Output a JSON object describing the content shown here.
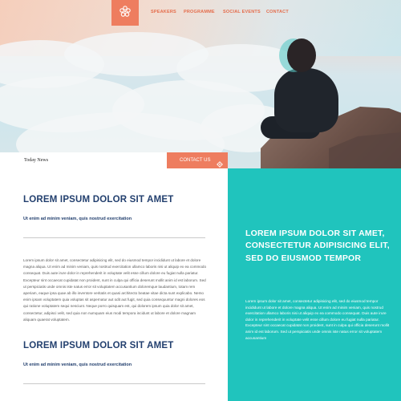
{
  "nav": {
    "items": [
      {
        "label": "SPEAKERS"
      },
      {
        "label": "PROGRAMME"
      },
      {
        "label": "SOCIAL EVENTS"
      },
      {
        "label": "CONTACT"
      }
    ]
  },
  "subbar": {
    "today_news": "Today News",
    "contact_label": "CONTACT US"
  },
  "main": {
    "heading_1": "LOREM IPSUM DOLOR SIT AMET",
    "subheading_1": "Ut enim ad minim veniam, quis nostrud exercitation",
    "paragraph": "Lorem ipsum dolor sit amet, consectetur adipisicing elit, sed do eiusmod tempor incididunt ut labore et dolore magna aliqua. Ut enim ad minim veniam, quis nostrud exercitation ullamco laboris nisi ut aliquip ex ea commodo consequat. Duis aute irure dolor in reprehenderit in voluptate velit esse cillum dolore eu fugiat nulla pariatur. Excepteur sint occaecat cupidatat non proident, sunt in culpa qui officia deserunt mollit anim id est laborum. Sed ut perspiciatis unde omnis iste natus error sit voluptatem accusantium doloremque laudantium, totam rem aperiam, eaque ipsa quae ab illo inventore veritatis et quasi architecto beatae vitae dicta sunt explicabo. Nemo enim ipsam voluptatem quia voluptas sit aspernatur aut odit aut fugit, sed quia consequuntur magni dolores eos qui ratione voluptatem sequi nesciunt. Neque porro quisquam est, qui dolorem ipsum quia dolor sit amet, consectetur, adipisci velit, sed quia non numquam eius modi tempora incidunt ut labore et dolore magnam aliquam quaerat voluptatem.",
    "heading_2": "LOREM IPSUM DOLOR SIT AMET",
    "subheading_2": "Ut enim ad minim veniam, quis nostrud exercitation"
  },
  "sidebar": {
    "title": "LOREM IPSUM DOLOR SIT AMET, CONSECTETUR ADIPISICING ELIT, SED DO EIUSMOD TEMPOR",
    "body": "Lorem ipsum dolor sit amet, consectetur adipisicing elit, sed do eiusmod tempor incididunt ut labore et dolore magna aliqua. Ut enim ad minim veniam, quis nostrud exercitation ullamco laboris nisi ut aliquip ex ea commodo consequat. Duis aute irure dolor in reprehenderit in voluptate velit esse cillum dolore eu fugiat nulla pariatur. Excepteur sint occaecat cupidatat non proident, sunt in culpa qui officia deserunt mollit anim id est laborum. Sed ut perspiciatis unde omnis iste natus error sit voluptatem accusantium"
  },
  "colors": {
    "accent": "#ee7d5f",
    "teal": "#20c4bd",
    "heading": "#223f6e"
  },
  "icons": {
    "logo": "flower-logo-icon",
    "contact": "gear-icon"
  }
}
